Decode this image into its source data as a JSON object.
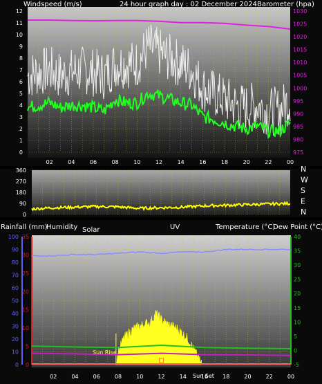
{
  "header": {
    "left_label": "Windspeed (m/s)",
    "center_label": "24 hour graph day : 02 December 2024",
    "right_label": "Barometer (hpa)"
  },
  "colors": {
    "grid": "#c8c800",
    "wind_gust": "#f0f0f0",
    "wind_avg": "#20ff20",
    "barometer": "#e020e0",
    "direction": "#ffff00",
    "rain_axis": "#6060ff",
    "humidity_axis": "#d02020",
    "humidity_line": "#8c8cff",
    "temperature": "#20c020",
    "dewpoint": "#c020c0",
    "rain_line": "#ff6060",
    "solar": "#ffff20",
    "uv": "#ff8020"
  },
  "hour_ticks": [
    "02",
    "04",
    "06",
    "08",
    "10",
    "12",
    "14",
    "16",
    "18",
    "20",
    "22",
    "00"
  ],
  "chart_data": [
    {
      "type": "line",
      "id": "wind-barometer",
      "x_unit": "hour",
      "xlim": [
        0,
        24
      ],
      "left_axis": {
        "label": "Windspeed (m/s)",
        "ylim": [
          0,
          12
        ],
        "ticks": [
          "0",
          "1",
          "2",
          "3",
          "4",
          "5",
          "6",
          "7",
          "8",
          "9",
          "10",
          "11",
          "12"
        ]
      },
      "right_axis": {
        "label": "Barometer (hpa)",
        "ylim": [
          975,
          1030
        ],
        "ticks": [
          "975",
          "980",
          "985",
          "990",
          "995",
          "1000",
          "1005",
          "1010",
          "1015",
          "1020",
          "1025",
          "1030"
        ]
      },
      "series": [
        {
          "name": "gust",
          "axis": "left",
          "x": [
            0,
            1,
            2,
            3,
            4,
            5,
            6,
            7,
            8,
            9,
            10,
            11,
            12,
            13,
            14,
            15,
            16,
            17,
            18,
            19,
            20,
            21,
            22,
            23,
            24
          ],
          "y": [
            6.5,
            6.8,
            7.0,
            6.5,
            6.8,
            7.0,
            6.8,
            6.5,
            7.5,
            7.5,
            7.5,
            9.0,
            8.5,
            8.0,
            7.5,
            7.0,
            5.5,
            5.0,
            4.5,
            4.0,
            3.8,
            4.0,
            3.5,
            3.5,
            4.5
          ]
        },
        {
          "name": "average",
          "axis": "left",
          "x": [
            0,
            1,
            2,
            3,
            4,
            5,
            6,
            7,
            8,
            9,
            10,
            11,
            12,
            13,
            14,
            15,
            16,
            17,
            18,
            19,
            20,
            21,
            22,
            23,
            24
          ],
          "y": [
            3.8,
            4.0,
            4.2,
            3.8,
            4.0,
            4.0,
            3.8,
            3.5,
            4.5,
            4.2,
            4.2,
            5.0,
            4.8,
            4.5,
            4.2,
            4.0,
            3.0,
            2.8,
            2.5,
            2.2,
            2.0,
            2.2,
            1.8,
            1.8,
            2.5
          ]
        },
        {
          "name": "barometer",
          "axis": "right",
          "x": [
            0,
            2,
            4,
            6,
            8,
            10,
            12,
            14,
            16,
            18,
            20,
            22,
            24
          ],
          "y": [
            1026.5,
            1026.5,
            1026.3,
            1026.2,
            1026.3,
            1026.3,
            1026.0,
            1025.5,
            1025.5,
            1025.2,
            1024.5,
            1024.0,
            1023.0
          ]
        }
      ]
    },
    {
      "type": "line",
      "id": "wind-direction",
      "x_unit": "hour",
      "xlim": [
        0,
        24
      ],
      "left_axis": {
        "ylim": [
          0,
          360
        ],
        "ticks": [
          "0",
          "90",
          "180",
          "270",
          "360"
        ]
      },
      "right_axis": {
        "ticks": [
          "N",
          "W",
          "S",
          "E",
          "N"
        ]
      },
      "series": [
        {
          "name": "direction",
          "x": [
            0,
            2,
            4,
            6,
            8,
            10,
            12,
            14,
            16,
            18,
            20,
            22,
            24
          ],
          "y": [
            45,
            55,
            60,
            65,
            62,
            50,
            55,
            60,
            70,
            75,
            80,
            85,
            90
          ]
        }
      ]
    },
    {
      "type": "line",
      "id": "rain-humidity-solar-temp",
      "x_unit": "hour",
      "xlim": [
        0,
        24
      ],
      "labels": {
        "rain": "Rainfall (mm)",
        "humidity": "Humidity",
        "solar": "Solar",
        "uv": "UV",
        "temperature": "Temperature (°C)",
        "dewpoint": "Dew Point (°C)"
      },
      "rain_axis": {
        "ylim": [
          0,
          100
        ],
        "ticks": [
          "0",
          "10",
          "20",
          "30",
          "40",
          "50",
          "60",
          "70",
          "80",
          "90",
          "100"
        ]
      },
      "humidity_axis": {
        "ylim": [
          0,
          35
        ],
        "ticks": [
          "0",
          "5",
          "10",
          "15",
          "20",
          "25",
          "30",
          "35"
        ]
      },
      "temperature_axis": {
        "ylim": [
          -5,
          40
        ],
        "ticks": [
          "-5",
          "0",
          "5",
          "10",
          "15",
          "20",
          "25",
          "30",
          "35",
          "40"
        ]
      },
      "annotations": {
        "sunrise": "Sun Rise",
        "sunset": "Sun Set",
        "sunrise_hour": 7.8,
        "sunset_hour": 15.7
      },
      "series": [
        {
          "name": "humidity",
          "x": [
            0,
            2,
            4,
            6,
            8,
            10,
            12,
            14,
            16,
            18,
            20,
            22,
            24
          ],
          "y": [
            85,
            85,
            86,
            86,
            87,
            88,
            87,
            88,
            88,
            90,
            90,
            90,
            90
          ]
        },
        {
          "name": "temperature",
          "x": [
            0,
            4,
            8,
            12,
            16,
            20,
            24
          ],
          "y": [
            1.5,
            1.2,
            1.0,
            1.8,
            1.0,
            0.8,
            0.6
          ]
        },
        {
          "name": "dewpoint",
          "x": [
            0,
            4,
            8,
            12,
            16,
            20,
            24
          ],
          "y": [
            -1.0,
            -1.2,
            -1.5,
            -1.0,
            -1.5,
            -1.6,
            -1.8
          ]
        },
        {
          "name": "rainfall",
          "x": [
            0,
            24
          ],
          "y": [
            0,
            0
          ]
        },
        {
          "name": "solar",
          "x": [
            7.8,
            8,
            8.5,
            9,
            9.5,
            10,
            10.5,
            11,
            11.5,
            12,
            12.5,
            13,
            13.5,
            14,
            14.5,
            15,
            15.5,
            15.7
          ],
          "y": [
            0,
            10,
            20,
            25,
            28,
            30,
            32,
            33,
            40,
            35,
            32,
            30,
            28,
            24,
            20,
            12,
            4,
            0
          ]
        }
      ]
    }
  ]
}
